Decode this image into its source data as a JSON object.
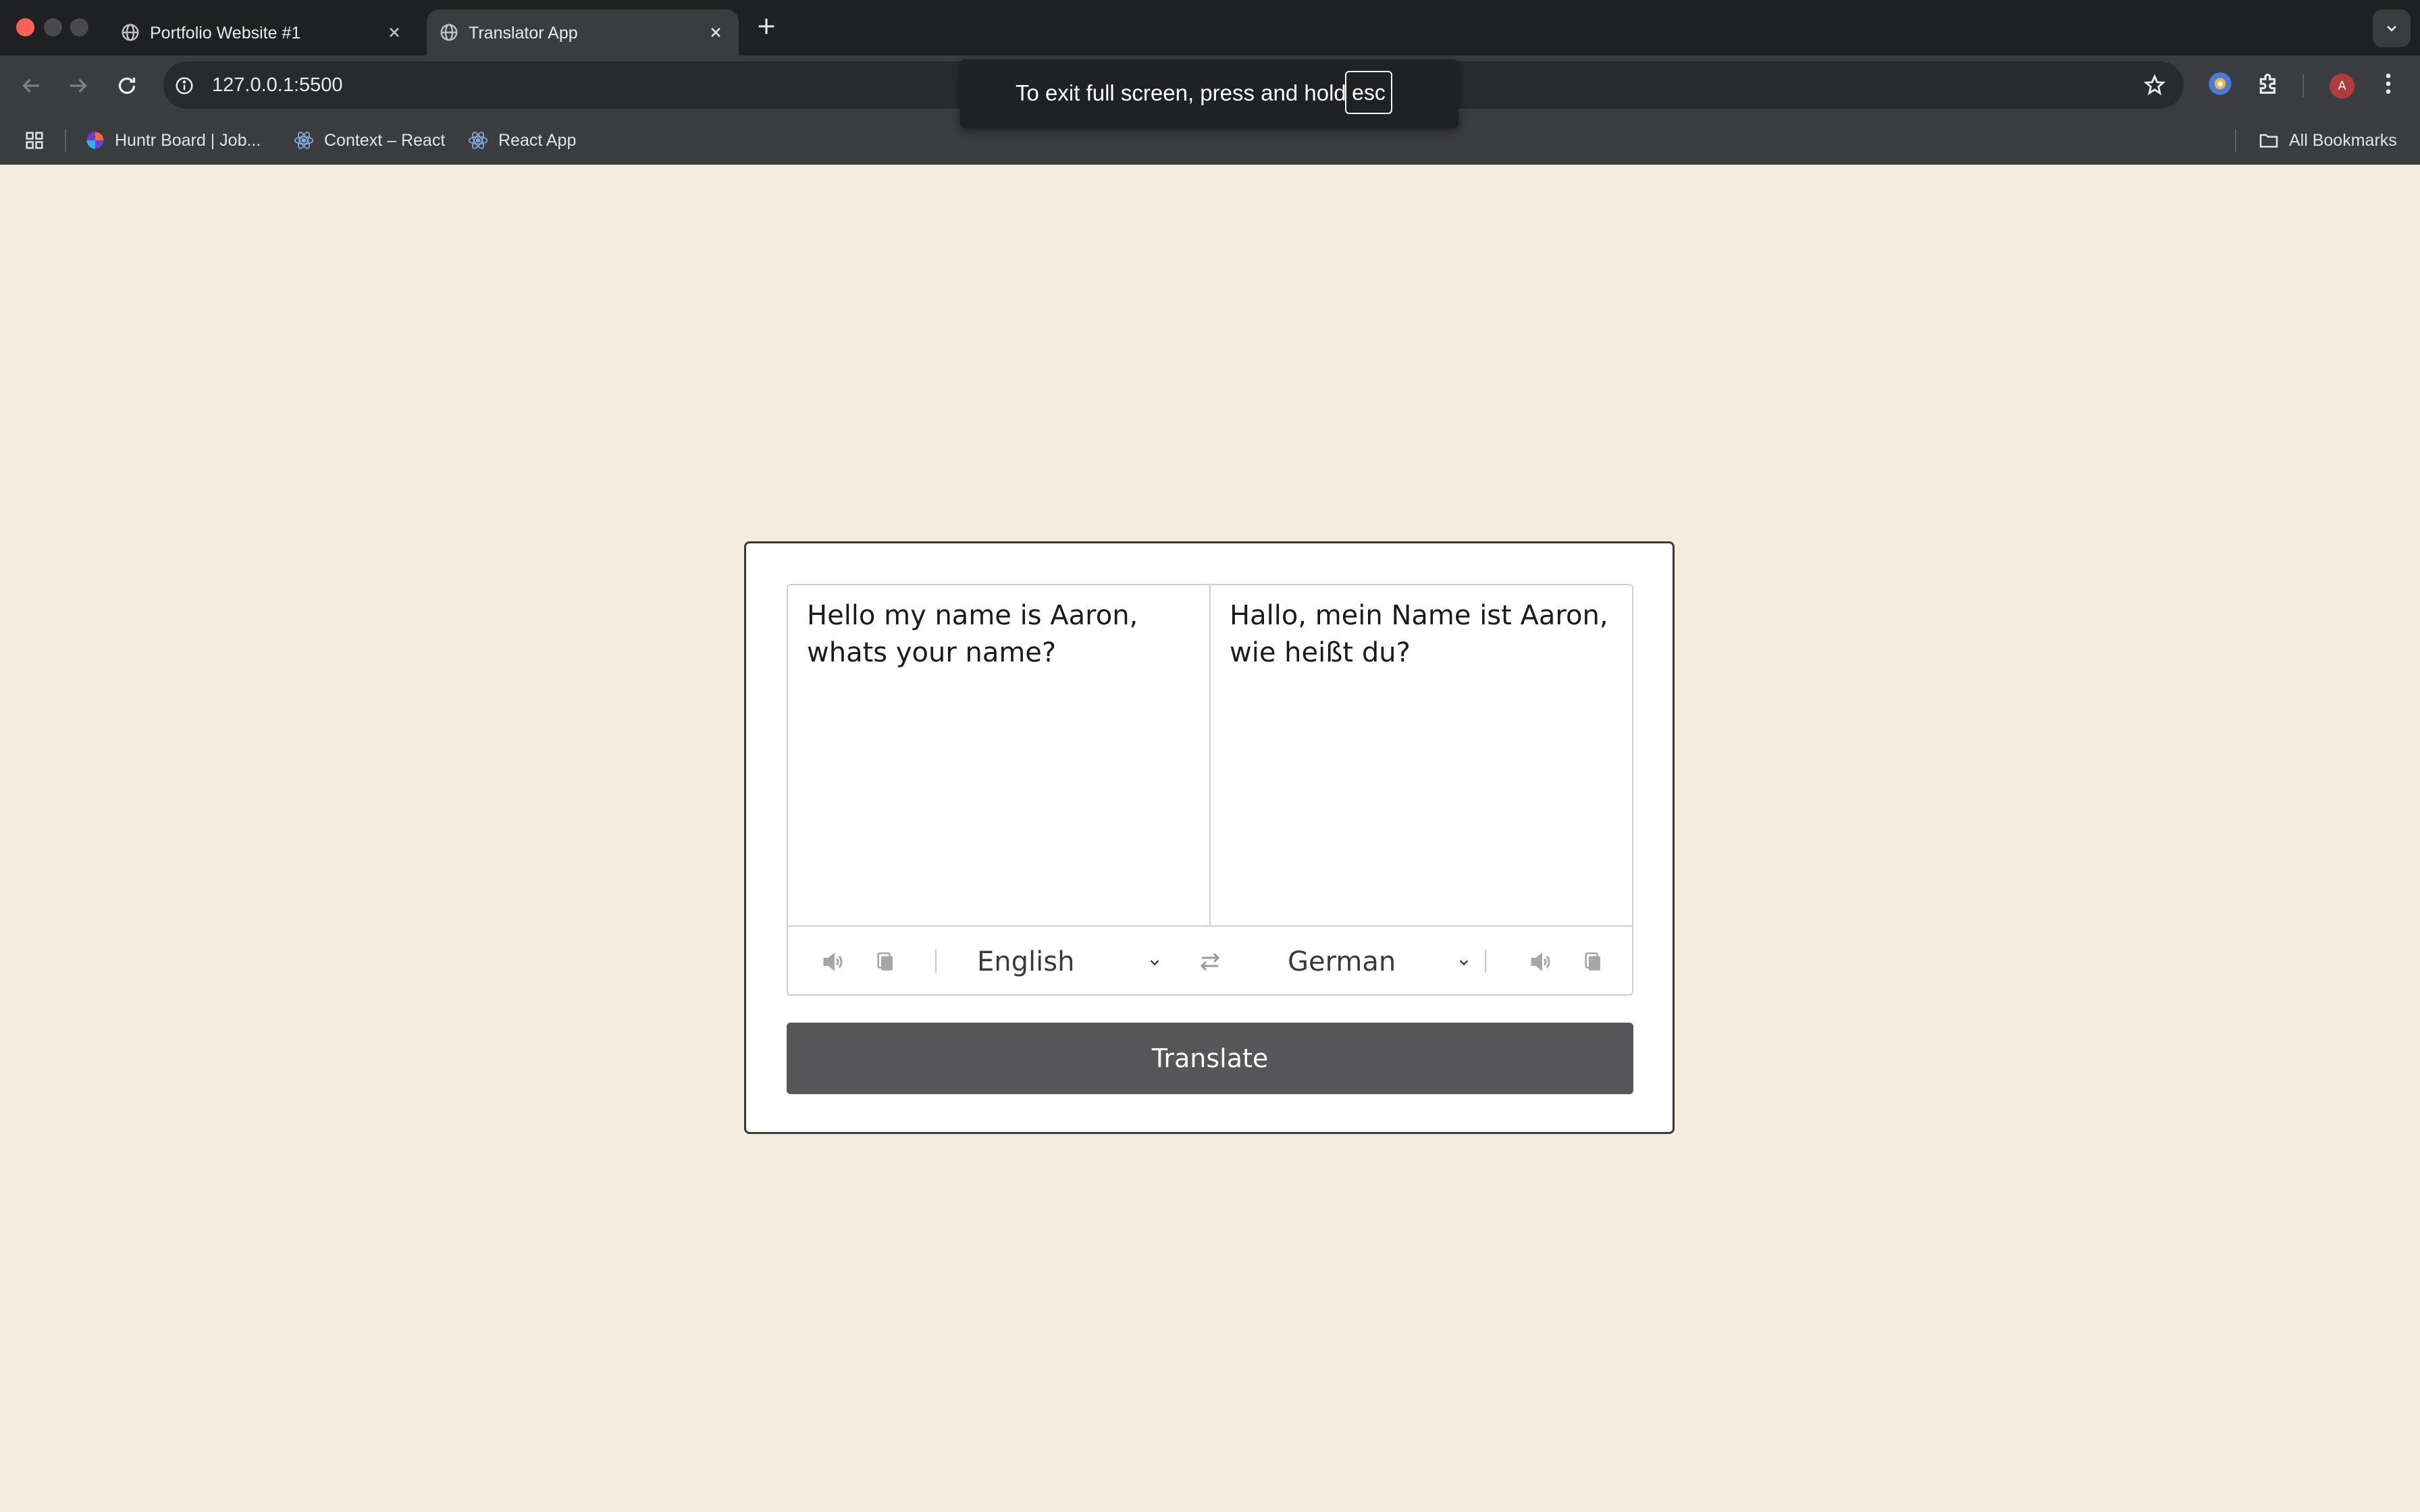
{
  "browser": {
    "tabs": [
      {
        "title": "Portfolio Website #1",
        "active": false
      },
      {
        "title": "Translator App",
        "active": true
      }
    ],
    "address": "127.0.0.1:5500",
    "avatar_letter": "A",
    "bookmarks": [
      {
        "label": "Huntr Board | Job...",
        "icon": "huntr-logo-icon"
      },
      {
        "label": "Context – React",
        "icon": "react-logo-icon"
      },
      {
        "label": "React App",
        "icon": "react-logo-icon"
      }
    ],
    "all_bookmarks": "All Bookmarks"
  },
  "fullscreen_notice": {
    "text": "To exit full screen, press and hold",
    "key": "esc"
  },
  "translator": {
    "from_text": "Hello my name is Aaron, whats your name?",
    "to_text": "Hallo, mein Name ist Aaron, wie heißt du?",
    "from_language": "English",
    "to_language": "German",
    "translate_label": "Translate"
  },
  "colors": {
    "page_background": "#f4ecdc",
    "button": "#565557",
    "browser_chrome": "#3b3c3f"
  }
}
